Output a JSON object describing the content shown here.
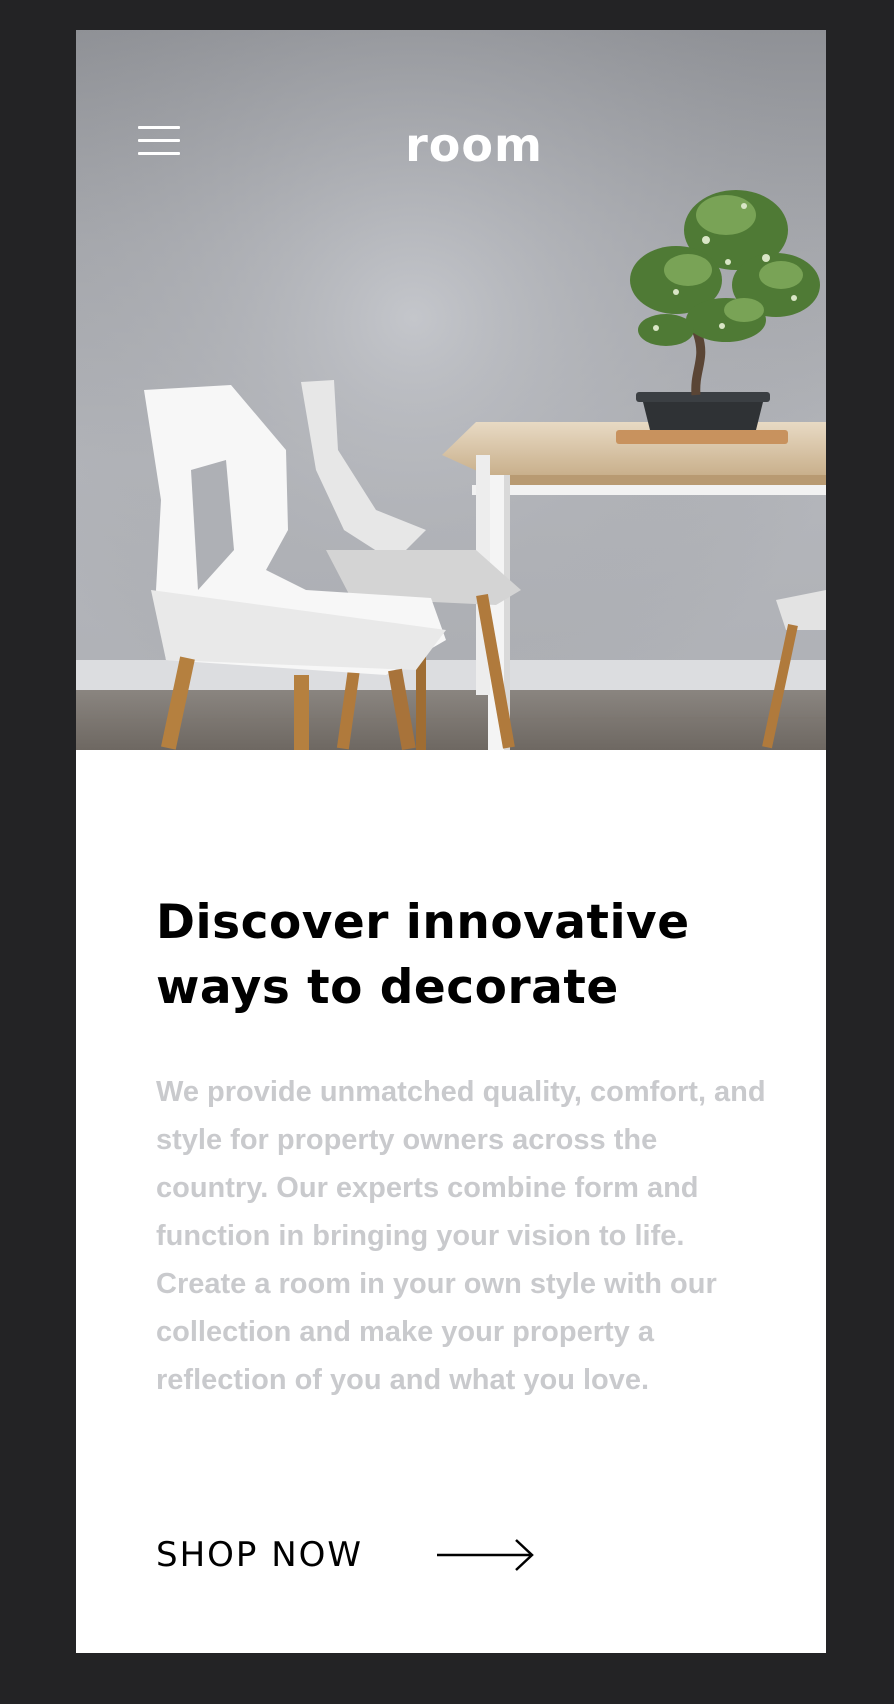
{
  "header": {
    "logo": "room",
    "menu_icon": "hamburger-icon"
  },
  "hero": {
    "image_subject": "white chairs with wooden table and bonsai plant"
  },
  "content": {
    "headline": "Discover innovative ways to decorate",
    "body": "We provide unmatched quality, comfort, and style for property owners across the country. Our experts combine form and function in bringing your vision to life. Create a room in your own style with our collection and make your property a reflection of you and what you love.",
    "cta_label": "SHOP NOW",
    "cta_icon": "arrow-right-icon"
  },
  "colors": {
    "background": "#232325",
    "card": "#ffffff",
    "headline": "#000000",
    "body_text": "#c9cacd"
  }
}
